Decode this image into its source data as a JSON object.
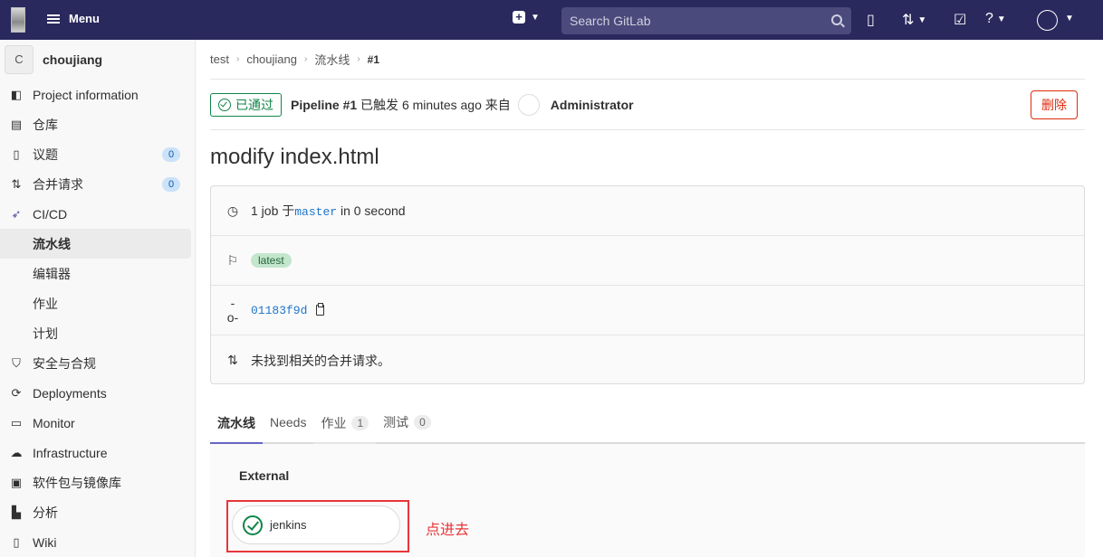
{
  "topbar": {
    "menu_label": "Menu",
    "search_placeholder": "Search GitLab"
  },
  "sidebar": {
    "project_initial": "C",
    "project_name": "choujiang",
    "items": [
      {
        "label": "Project information",
        "icon": "info-icon"
      },
      {
        "label": "仓库",
        "icon": "doc-icon"
      },
      {
        "label": "议题",
        "icon": "issues-icon",
        "badge": "0"
      },
      {
        "label": "合并请求",
        "icon": "merge-request-icon",
        "badge": "0"
      },
      {
        "label": "CI/CD",
        "icon": "rocket-icon"
      },
      {
        "label": "流水线",
        "active": true
      },
      {
        "label": "编辑器"
      },
      {
        "label": "作业"
      },
      {
        "label": "计划"
      },
      {
        "label": "安全与合规",
        "icon": "shield-icon"
      },
      {
        "label": "Deployments",
        "icon": "deployments-icon"
      },
      {
        "label": "Monitor",
        "icon": "monitor-icon"
      },
      {
        "label": "Infrastructure",
        "icon": "cloud-icon"
      },
      {
        "label": "软件包与镜像库",
        "icon": "package-icon"
      },
      {
        "label": "分析",
        "icon": "chart-icon"
      },
      {
        "label": "Wiki",
        "icon": "book-icon"
      }
    ]
  },
  "breadcrumb": [
    "test",
    "choujiang",
    "流水线",
    "#1"
  ],
  "pipeline": {
    "status": "已通过",
    "title": "Pipeline #1",
    "triggered_text": "已触发",
    "time": "6 minutes ago",
    "from_text": "来自",
    "user": "Administrator",
    "delete_label": "删除",
    "commit_title": "modify index.html"
  },
  "info": {
    "jobs_prefix": "1 job 于",
    "branch": "master",
    "jobs_suffix": "in 0 second",
    "tag": "latest",
    "sha": "01183f9d",
    "mr_text": "未找到相关的合并请求。"
  },
  "tabs": [
    {
      "label": "流水线",
      "active": true
    },
    {
      "label": "Needs"
    },
    {
      "label": "作业",
      "count": "1"
    },
    {
      "label": "测试",
      "count": "0"
    }
  ],
  "graph": {
    "stage": "External",
    "job_name": "jenkins",
    "annotation": "点进去"
  },
  "colors": {
    "topbar": "#29295e",
    "success": "#108548",
    "danger": "#dd2b0e",
    "annotation": "#e8353a",
    "link": "#1f75cb"
  }
}
